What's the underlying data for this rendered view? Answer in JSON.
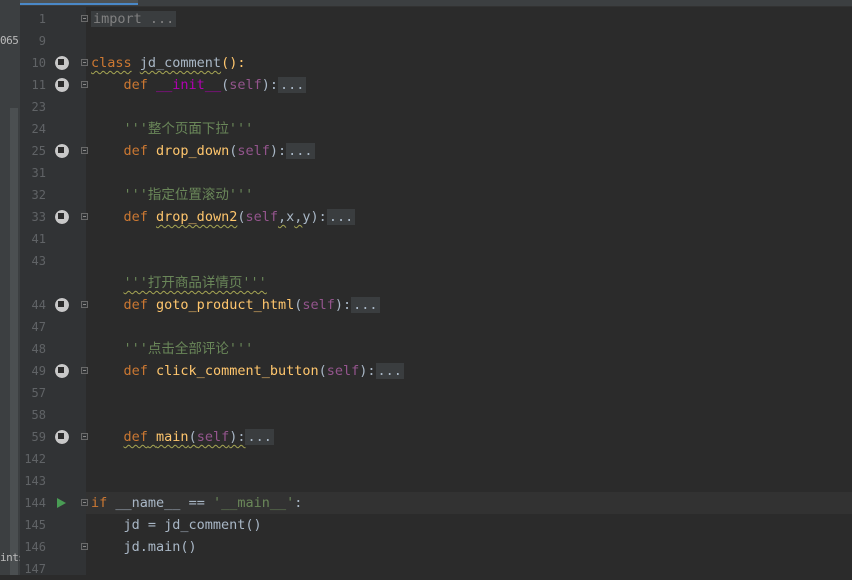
{
  "left_panel": {
    "stub_top": "065",
    "stub_bottom": "ints"
  },
  "tabs": [
    {
      "label": ""
    }
  ],
  "line_numbers": [
    "1",
    "9",
    "10",
    "11",
    "23",
    "24",
    "25",
    "31",
    "32",
    "33",
    "41",
    "43",
    "44",
    "47",
    "48",
    "49",
    "57",
    "58",
    "59",
    "142",
    "143",
    "144",
    "145",
    "146",
    "147"
  ],
  "code": {
    "import": "import ...",
    "class_kw": "class",
    "class_name": "jd_comment",
    "class_rest": "():",
    "def": "def",
    "init_name": "__init__",
    "self": "self",
    "fold": "...",
    "paren_open": "(",
    "paren_close_colon": "):",
    "doc1": "'''整个页面下拉'''",
    "drop_down": "drop_down",
    "doc2": "'''指定位置滚动'''",
    "drop_down2": "drop_down2",
    "x": "x",
    "y": "y",
    "comma": ",",
    "doc3": "'''打开商品详情页'''",
    "goto_product_html": "goto_product_html",
    "doc4": "'''点击全部评论'''",
    "click_comment_button": "click_comment_button",
    "main_name": "main",
    "if_kw": "if",
    "name_var": "__name__",
    "eq": "==",
    "main_str": "'__main__'",
    "colon": ":",
    "jd_assign": "jd = jd_comment()",
    "jd_main": "jd.main()"
  },
  "colors": {
    "background": "#2b2b2b",
    "keyword": "#cc7832",
    "function": "#ffc66d",
    "self": "#94558d",
    "string": "#6a8759",
    "run": "#499c54"
  }
}
